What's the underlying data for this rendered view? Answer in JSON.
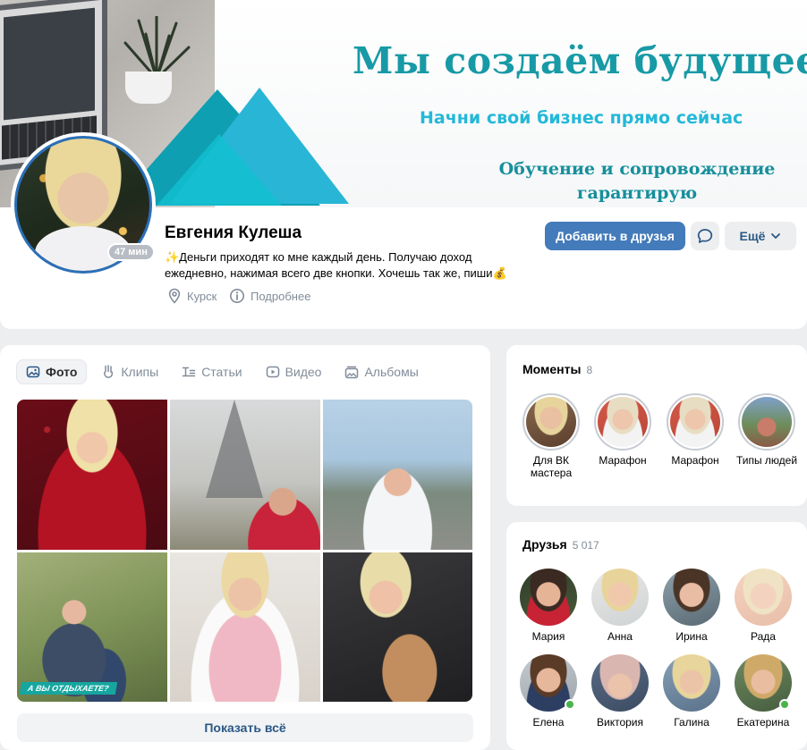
{
  "cover": {
    "title": "Мы создаём будущее",
    "subtitle": "Начни свой бизнес прямо сейчас",
    "note": "Обучение и сопровождение гарантирую"
  },
  "profile": {
    "name": "Евгения Кулеша",
    "last_seen": "47 мин",
    "status": "✨Деньги приходят ко мне каждый день. Получаю доход ежедневно, нажимая всего две кнопки. Хочешь так же, пиши💰",
    "city": "Курск",
    "details_label": "Подробнее"
  },
  "actions": {
    "add_friend_label": "Добавить в друзья",
    "more_label": "Ещё"
  },
  "media": {
    "tabs": [
      {
        "label": "Фото",
        "icon": "photo-icon",
        "active": true
      },
      {
        "label": "Клипы",
        "icon": "clips-icon",
        "active": false
      },
      {
        "label": "Статьи",
        "icon": "articles-icon",
        "active": false
      },
      {
        "label": "Видео",
        "icon": "video-icon",
        "active": false
      },
      {
        "label": "Альбомы",
        "icon": "albums-icon",
        "active": false
      }
    ],
    "photo_caption": "А ВЫ ОТДЫХАЕТЕ?",
    "show_all_label": "Показать всё"
  },
  "moments": {
    "title": "Моменты",
    "count": "8",
    "items": [
      {
        "label": "Для ВК мастера"
      },
      {
        "label": "Марафон"
      },
      {
        "label": "Марафон"
      },
      {
        "label": "Типы людей"
      }
    ]
  },
  "friends": {
    "title": "Друзья",
    "count": "5 017",
    "items": [
      {
        "name": "Мария",
        "online": false
      },
      {
        "name": "Анна",
        "online": false
      },
      {
        "name": "Ирина",
        "online": false
      },
      {
        "name": "Рада",
        "online": false
      },
      {
        "name": "Елена",
        "online": true
      },
      {
        "name": "Виктория",
        "online": false
      },
      {
        "name": "Галина",
        "online": false
      },
      {
        "name": "Екатерина",
        "online": true
      }
    ]
  },
  "colors": {
    "accent": "#447bba",
    "link": "#2a5885",
    "cover_teal": "#179aa6",
    "cover_cyan": "#24b8d8",
    "online": "#4bb34b",
    "background": "#edeef0"
  }
}
